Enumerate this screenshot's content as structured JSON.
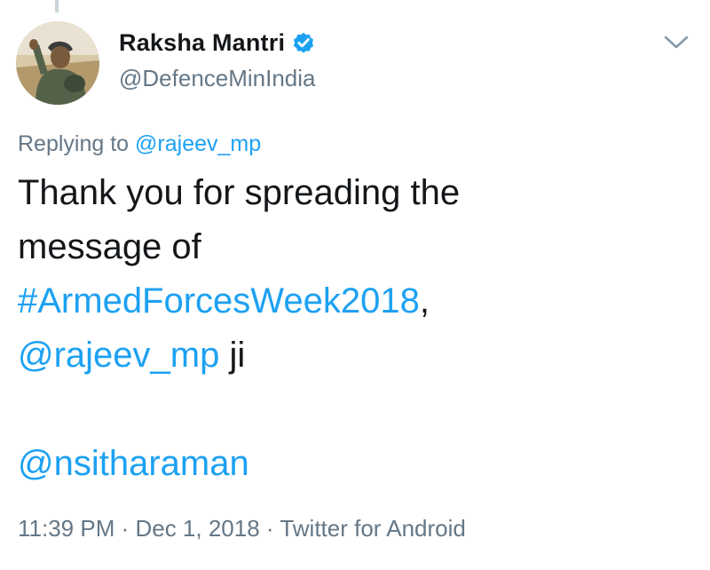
{
  "author": {
    "display_name": "Raksha Mantri",
    "handle": "@DefenceMinIndia",
    "verified_icon": "verified-badge-icon",
    "avatar": "profile-photo"
  },
  "menu": {
    "icon": "chevron-down-icon"
  },
  "reply_context": {
    "prefix": "Replying to ",
    "mention": "@rajeev_mp"
  },
  "body": {
    "line1": "Thank you for spreading the",
    "line2": "message of",
    "hashtag": "#ArmedForcesWeek2018",
    "comma": ",",
    "mention": "@rajeev_mp",
    "suffix": " ji",
    "mention2": "@nsitharaman"
  },
  "meta": {
    "time": "11:39 PM",
    "separator": " · ",
    "date": "Dec 1, 2018",
    "source": "Twitter for Android"
  },
  "colors": {
    "link": "#1da1f2",
    "secondary_text": "#657786",
    "primary_text": "#14171a"
  }
}
